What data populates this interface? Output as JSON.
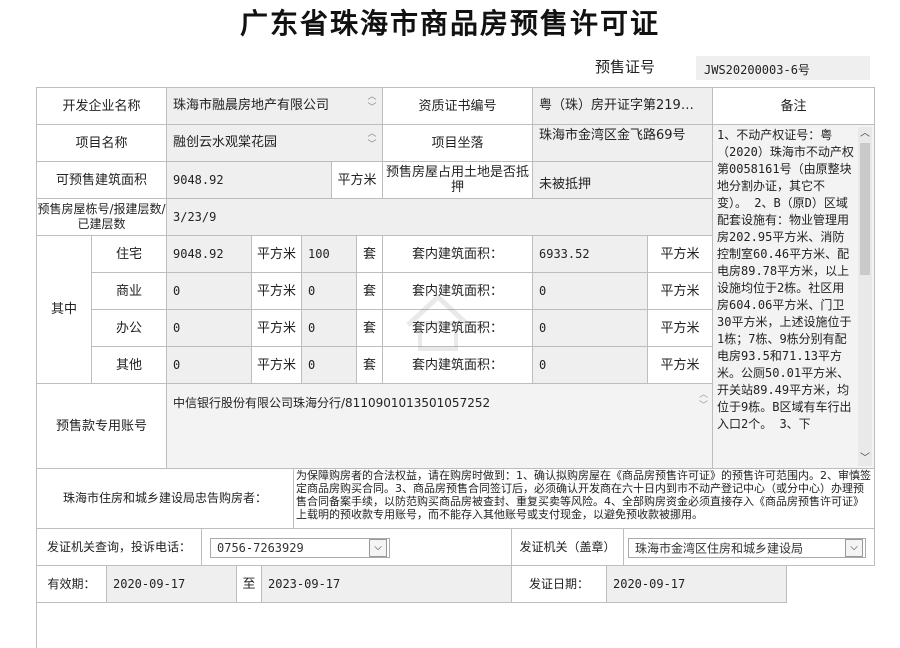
{
  "title": "广东省珠海市商品房预售许可证",
  "permit": {
    "label": "预售证号",
    "value": "JWS20200003-6号"
  },
  "row1": {
    "developer_label": "开发企业名称",
    "developer_value": "珠海市融晨房地产有限公司",
    "cert_label": "资质证书编号",
    "cert_value": "粤（珠）房开证字第219…",
    "remark_label": "备注"
  },
  "row2": {
    "project_label": "项目名称",
    "project_value": "融创云水观棠花园",
    "location_label": "项目坐落",
    "location_value": "珠海市金湾区金飞路69号"
  },
  "row3": {
    "area_label": "可预售建筑面积",
    "area_value": "9048.92",
    "area_unit": "平方米",
    "mortgage_label": "预售房屋占用土地是否抵押",
    "mortgage_value": "未被抵押"
  },
  "row4": {
    "floors_label": "预售房屋栋号/报建层数/已建层数",
    "floors_value": "3/23/9"
  },
  "breakdown": {
    "group_label": "其中",
    "rows": [
      {
        "type": "住宅",
        "area": "9048.92",
        "unit": "平方米",
        "sets": "100",
        "sets_unit": "套",
        "inner_label": "套内建筑面积：",
        "inner_value": "6933.52",
        "inner_unit": "平方米"
      },
      {
        "type": "商业",
        "area": "0",
        "unit": "平方米",
        "sets": "0",
        "sets_unit": "套",
        "inner_label": "套内建筑面积：",
        "inner_value": "0",
        "inner_unit": "平方米"
      },
      {
        "type": "办公",
        "area": "0",
        "unit": "平方米",
        "sets": "0",
        "sets_unit": "套",
        "inner_label": "套内建筑面积：",
        "inner_value": "0",
        "inner_unit": "平方米"
      },
      {
        "type": "其他",
        "area": "0",
        "unit": "平方米",
        "sets": "0",
        "sets_unit": "套",
        "inner_label": "套内建筑面积：",
        "inner_value": "0",
        "inner_unit": "平方米"
      }
    ]
  },
  "account": {
    "label": "预售款专用账号",
    "value": "中信银行股份有限公司珠海分行/8110901013501057252"
  },
  "remark_text": "1、不动产权证号：粤（2020）珠海市不动产权第0058161号（由原整块地分割办证，其它不变）。 2、B（原D）区域配套设施有：物业管理用房202.95平方米、消防控制室60.46平方米、配电房89.78平方米，以上设施均位于2栋。社区用房604.06平方米、门卫30平方米，上述设施位于1栋；7栋、9栋分别有配电房93.5和71.13平方米。公厕50.01平方米、开关站89.49平方米，均位于9栋。B区域有车行出入口2个。 3、下",
  "notice": {
    "label": "珠海市住房和城乡建设局忠告购房者：",
    "text": "为保障购房者的合法权益，请在购房时做到：1、确认拟购房屋在《商品房预售许可证》的预售许可范围内。2、审慎签定商品房购买合同。3、商品房预售合同签订后，必须确认开发商在六十日内到市不动产登记中心（或分中心）办理预售合同备案手续，以防范购买商品房被查封、重复买卖等风险。4、全部购房资金必须直接存入《商品房预售许可证》上载明的预收款专用账号，而不能存入其他账号或支付现金，以避免预收款被挪用。"
  },
  "contact": {
    "query_label": "发证机关查询，投诉电话：",
    "query_value": "0756-7263929",
    "issuer_label": "发证机关（盖章）",
    "issuer_value": "珠海市金湾区住房和城乡建设局"
  },
  "validity": {
    "from_label": "有效期：",
    "from_value": "2020-09-17",
    "to_label": "至",
    "to_value": "2023-09-17",
    "issue_label": "发证日期：",
    "issue_value": "2020-09-17"
  }
}
